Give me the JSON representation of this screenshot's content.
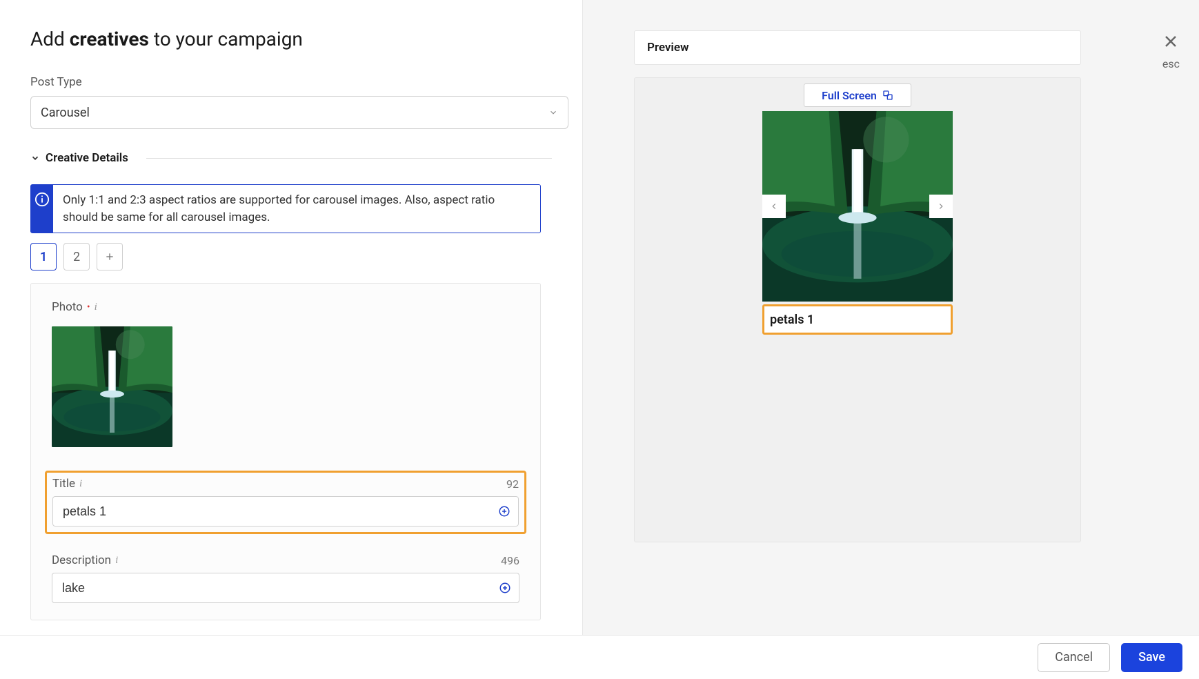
{
  "header": {
    "title_prefix": "Add ",
    "title_bold": "creatives",
    "title_suffix": " to your campaign"
  },
  "post_type": {
    "label": "Post Type",
    "value": "Carousel"
  },
  "section": {
    "title": "Creative Details"
  },
  "info_banner": {
    "message": "Only 1:1 and 2:3 aspect ratios are supported for carousel images. Also, aspect ratio should be same for all carousel images."
  },
  "tabs": [
    "1",
    "2"
  ],
  "active_tab_index": 0,
  "slide": {
    "photo_label": "Photo",
    "title_label": "Title",
    "title_value": "petals 1",
    "title_remaining": "92",
    "description_label": "Description",
    "description_value": "lake",
    "description_remaining": "496"
  },
  "preview": {
    "header": "Preview",
    "fullscreen_label": "Full Screen",
    "caption": "petals 1"
  },
  "close": {
    "esc_label": "esc"
  },
  "footer": {
    "cancel": "Cancel",
    "save": "Save"
  }
}
